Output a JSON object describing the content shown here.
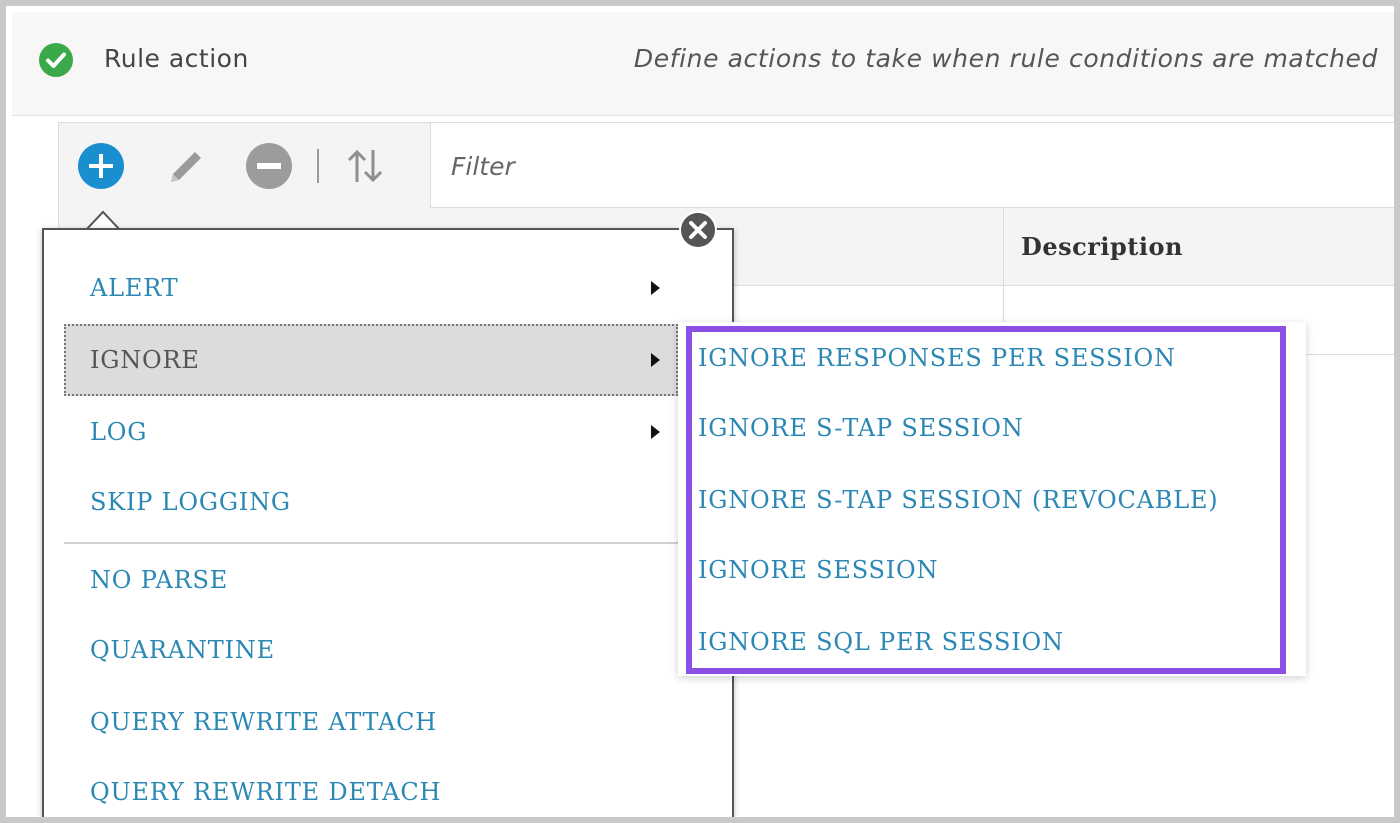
{
  "header": {
    "title": "Rule action",
    "description": "Define actions to take when rule conditions are matched",
    "status_icon": "check-circle-icon"
  },
  "toolbar": {
    "add_icon": "plus-circle-icon",
    "edit_icon": "pencil-icon",
    "remove_icon": "minus-circle-icon",
    "sort_icon": "sort-arrows-icon",
    "filter_placeholder": "Filter"
  },
  "table": {
    "columns": [
      "Description"
    ]
  },
  "menu": {
    "items": [
      {
        "label": "ALERT",
        "has_submenu": true
      },
      {
        "label": "IGNORE",
        "has_submenu": true,
        "active": true
      },
      {
        "label": "LOG",
        "has_submenu": true
      },
      {
        "label": "SKIP LOGGING",
        "has_submenu": false
      },
      {
        "label": "NO PARSE",
        "has_submenu": false
      },
      {
        "label": "QUARANTINE",
        "has_submenu": false
      },
      {
        "label": "QUERY REWRITE ATTACH",
        "has_submenu": false
      },
      {
        "label": "QUERY REWRITE DETACH",
        "has_submenu": false
      }
    ],
    "close_icon": "close-circle-icon"
  },
  "submenu": {
    "items": [
      "IGNORE RESPONSES PER SESSION",
      "IGNORE S-TAP SESSION",
      "IGNORE S-TAP SESSION (REVOCABLE)",
      "IGNORE SESSION",
      "IGNORE SQL PER SESSION"
    ],
    "highlight_color": "#8b4fe6"
  },
  "colors": {
    "link": "#2b87b4",
    "accent_blue": "#1a8fd0",
    "success_green": "#3aa94a"
  }
}
